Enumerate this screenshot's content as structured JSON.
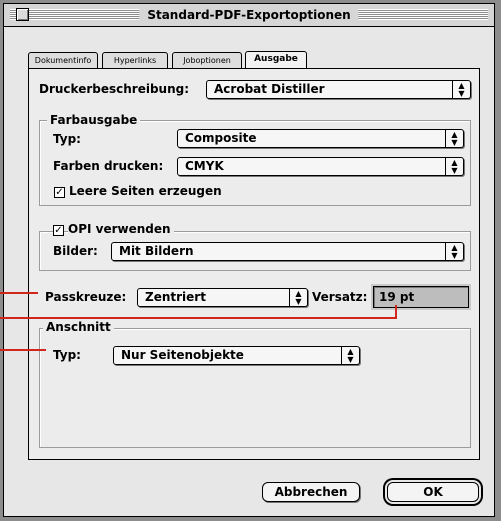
{
  "window": {
    "title": "Standard-PDF-Exportoptionen"
  },
  "tabs": [
    {
      "label": "Dokumentinfo"
    },
    {
      "label": "Hyperlinks"
    },
    {
      "label": "Joboptionen"
    },
    {
      "label": "Ausgabe"
    }
  ],
  "active_tab": "Ausgabe",
  "printer": {
    "label": "Druckerbeschreibung:",
    "value": "Acrobat Distiller"
  },
  "color_output": {
    "group_label": "Farbausgabe",
    "type_label": "Typ:",
    "type_value": "Composite",
    "print_colors_label": "Farben drucken:",
    "print_colors_value": "CMYK",
    "blank_pages_label": "Leere Seiten erzeugen",
    "blank_pages_checked": true
  },
  "opi": {
    "checkbox_label": "OPI verwenden",
    "checked": true,
    "images_label": "Bilder:",
    "images_value": "Mit Bildern"
  },
  "marks": {
    "registration_label": "Passkreuze:",
    "registration_value": "Zentriert",
    "offset_label": "Versatz:",
    "offset_value": "19 pt"
  },
  "bleed": {
    "group_label": "Anschnitt",
    "type_label": "Typ:",
    "type_value": "Nur Seitenobjekte"
  },
  "buttons": {
    "cancel": "Abbrechen",
    "ok": "OK"
  },
  "colors": {
    "callout": "#d0261c",
    "window_bg": "#e7e7e7",
    "field_bg": "#bdbdbd"
  }
}
